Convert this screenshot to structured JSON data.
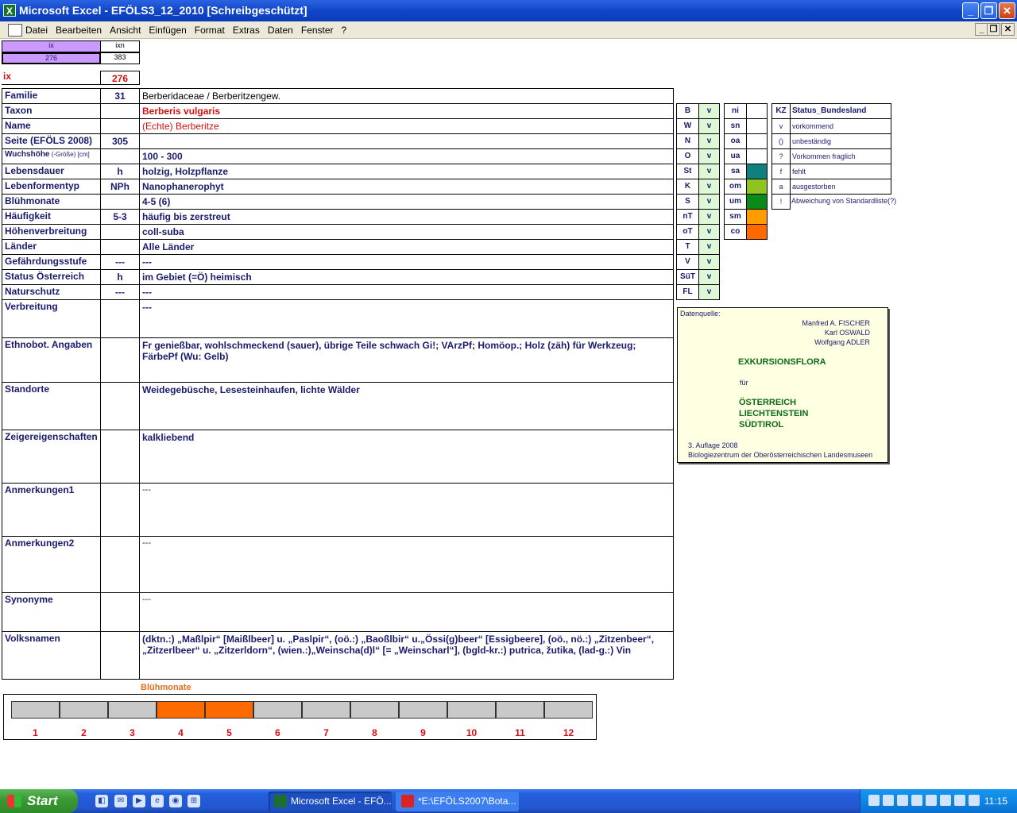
{
  "window": {
    "title": "Microsoft Excel - EFÖLS3_12_2010  [Schreibgeschützt]",
    "app_icon": "X",
    "min": "_",
    "restore": "❐",
    "close": "✕"
  },
  "menu": {
    "items": [
      "Datei",
      "Bearbeiten",
      "Ansicht",
      "Einfügen",
      "Format",
      "Extras",
      "Daten",
      "Fenster",
      "?"
    ],
    "mdi_min": "_",
    "mdi_restore": "❐",
    "mdi_close": "✕"
  },
  "top": {
    "ix_header": "ix",
    "ixn_header": "ixn",
    "ix_value": "276",
    "ixn_value": "383",
    "ix_label": "ix",
    "ix_big": "276"
  },
  "rows": [
    {
      "label": "Familie",
      "code": "31",
      "value": "Berberidaceae  /  Berberitzengew."
    },
    {
      "label": "Taxon",
      "code": "",
      "value": "Berberis vulgaris"
    },
    {
      "label": "Name",
      "code": "",
      "value": "(Echte) Berberitze"
    },
    {
      "label": "Seite (EFÖLS 2008)",
      "code": "305",
      "value": ""
    },
    {
      "label": "Wuchshöhe",
      "label_small": " (-Größe) [cm]",
      "code": "",
      "value": " 100 - 300"
    },
    {
      "label": "Lebensdauer",
      "code": "h",
      "value": "holzig, Holzpflanze"
    },
    {
      "label": "Lebenformentyp",
      "code": "NPh",
      "value": "Nanophanerophyt"
    },
    {
      "label": "Blühmonate",
      "code": "",
      "value": " 4-5 (6)"
    },
    {
      "label": "Häufigkeit",
      "code": "5-3",
      "value": "häufig bis zerstreut"
    },
    {
      "label": "Höhenverbreitung",
      "code": "",
      "value": "coll-suba"
    },
    {
      "label": "Länder",
      "code": "",
      "value": "Alle Länder"
    },
    {
      "label": "Gefährdungsstufe",
      "code": "---",
      "value": "  ---"
    },
    {
      "label": "Status Österreich",
      "code": "h",
      "value": "im Gebiet (=Ö) heimisch"
    },
    {
      "label": "Naturschutz",
      "code": "---",
      "value": " ---"
    },
    {
      "label": "Verbreitung",
      "code": "",
      "value": " ---"
    },
    {
      "label": "Ethnobot. Angaben",
      "code": "",
      "value": "Fr genießbar, wohlschmeckend (sauer), übrige Teile schwach Gi!; VArzPf; Homöop.; Holz (zäh) für Werkzeug; FärbePf (Wu: Gelb)"
    },
    {
      "label": "Standorte",
      "code": "",
      "value": "Weidegebüsche, Lesesteinhaufen, lichte Wälder"
    },
    {
      "label": "Zeigereigenschaften",
      "code": "",
      "value": " kalkliebend"
    },
    {
      "label": "Anmerkungen1",
      "code": "",
      "value": "---"
    },
    {
      "label": "Anmerkungen2",
      "code": "",
      "value": "---"
    },
    {
      "label": "Synonyme",
      "code": "",
      "value": "---"
    },
    {
      "label": "Volksnamen",
      "code": "",
      "value": "(dktn.:) „Maßlpir“ [Maißlbeer] u. „Paslpir“, (oö.:) „Baoßlbir“ u.„Össi(g)beer“ [Essigbeere], (oö., nö.:) „Zitzenbeer“, „Zitzerlbeer“ u. „Zitzerldorn“, (wien.:)„Weinscha(d)l“ [= „Weinscharl“], (bgld-kr.:) putrica, žutika, (lad-g.:) Vin"
    }
  ],
  "states": {
    "codes": [
      "B",
      "W",
      "N",
      "O",
      "St",
      "K",
      "S",
      "nT",
      "oT",
      "T",
      "V",
      "SüT",
      "FL"
    ],
    "values": [
      "v",
      "v",
      "v",
      "v",
      "v",
      "v",
      "v",
      "v",
      "v",
      "v",
      "v",
      "v",
      "v"
    ]
  },
  "heights": {
    "codes": [
      "ni",
      "sn",
      "oa",
      "ua",
      "sa",
      "om",
      "um",
      "sm",
      "co"
    ],
    "colors": [
      "#ffffff",
      "#ffffff",
      "#ffffff",
      "#ffffff",
      "#0f7f7f",
      "#8fc31f",
      "#0a8a1a",
      "#ff9c00",
      "#ff6a00"
    ]
  },
  "status_legend": {
    "header_kz": "KZ",
    "header_label": "Status_Bundesland",
    "items": [
      {
        "kz": "v",
        "text": "vorkommend"
      },
      {
        "kz": "()",
        "text": "unbeständig"
      },
      {
        "kz": "?",
        "text": "Vorkommen fraglich"
      },
      {
        "kz": "f",
        "text": "fehlt"
      },
      {
        "kz": "a",
        "text": "ausgestorben"
      },
      {
        "kz": "!",
        "text": "Abweichung von Standardliste(?)"
      }
    ]
  },
  "source": {
    "heading": "Datenquelle:",
    "authors": [
      "Manfred A. FISCHER",
      "Karl OSWALD",
      "Wolfgang ADLER"
    ],
    "title": "EXKURSIONSFLORA",
    "fuer": "für",
    "countries": [
      "ÖSTERREICH",
      "LIECHTENSTEIN",
      "SÜDTIROL"
    ],
    "edition": "3. Auflage 2008",
    "publisher": "Biologiezentrum der Oberösterreichischen Landesmuseen"
  },
  "bloom": {
    "title": "Blühmonate",
    "months": [
      "1",
      "2",
      "3",
      "4",
      "5",
      "6",
      "7",
      "8",
      "9",
      "10",
      "11",
      "12"
    ],
    "active": [
      false,
      false,
      false,
      true,
      true,
      false,
      false,
      false,
      false,
      false,
      false,
      false
    ],
    "on_color": "#ff6a00",
    "off_color": "#c9c9c9"
  },
  "taskbar": {
    "start": "Start",
    "tasks": [
      "Microsoft Excel - EFÖ...",
      "*E:\\EFÖLS2007\\Bota..."
    ],
    "clock": "11:15"
  }
}
